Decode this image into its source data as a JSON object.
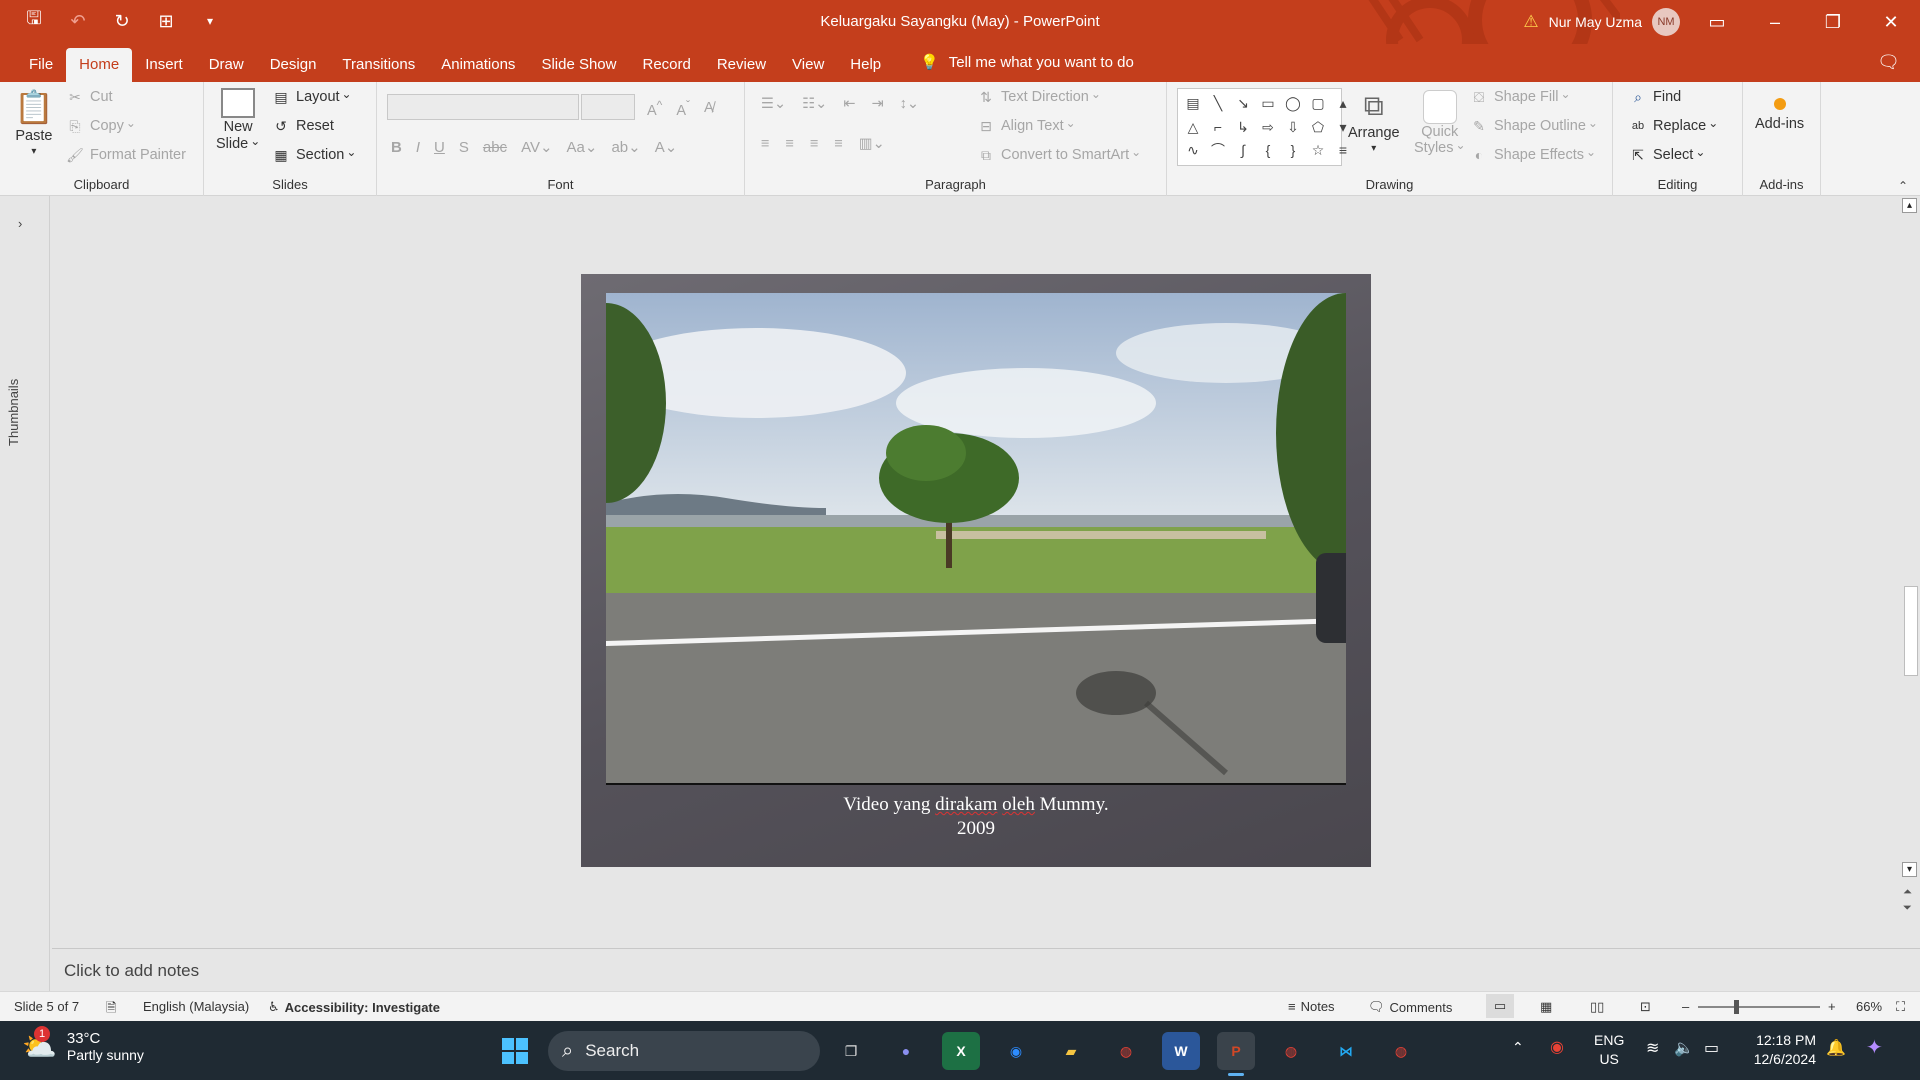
{
  "titlebar": {
    "document_title": "Keluargaku Sayangku (May)  -  PowerPoint",
    "user_name": "Nur May Uzma",
    "user_initials": "NM",
    "accent_color": "#c43e1c"
  },
  "tabs": [
    "File",
    "Home",
    "Insert",
    "Draw",
    "Design",
    "Transitions",
    "Animations",
    "Slide Show",
    "Record",
    "Review",
    "View",
    "Help"
  ],
  "active_tab": "Home",
  "tell_me": "Tell me what you want to do",
  "ribbon": {
    "clipboard": {
      "label": "Clipboard",
      "paste": "Paste",
      "cut": "Cut",
      "copy": "Copy",
      "format_painter": "Format Painter"
    },
    "slides": {
      "label": "Slides",
      "new_slide_1": "New",
      "new_slide_2": "Slide",
      "layout": "Layout",
      "reset": "Reset",
      "section": "Section"
    },
    "font": {
      "label": "Font"
    },
    "paragraph": {
      "label": "Paragraph",
      "text_direction": "Text Direction",
      "align_text": "Align Text",
      "convert_smartart": "Convert to SmartArt"
    },
    "drawing": {
      "label": "Drawing",
      "arrange": "Arrange",
      "quick_styles_1": "Quick",
      "quick_styles_2": "Styles",
      "shape_fill": "Shape Fill",
      "shape_outline": "Shape Outline",
      "shape_effects": "Shape Effects"
    },
    "editing": {
      "label": "Editing",
      "find": "Find",
      "replace": "Replace",
      "select": "Select"
    },
    "addins": {
      "label": "Add-ins",
      "button": "Add-ins"
    }
  },
  "thumbnails_label": "Thumbnails",
  "slide": {
    "caption_line1_a": "Video yang ",
    "caption_line1_b": "dirakam",
    "caption_line1_c": " ",
    "caption_line1_d": "oleh",
    "caption_line1_e": " Mummy.",
    "caption_line2": "2009"
  },
  "notes_placeholder": "Click to add notes",
  "status": {
    "slide_counter": "Slide 5 of 7",
    "language": "English (Malaysia)",
    "accessibility": "Accessibility: Investigate",
    "notes": "Notes",
    "comments": "Comments",
    "zoom": "66%",
    "zoom_fraction": 0.66
  },
  "taskbar": {
    "weather_temp": "33°C",
    "weather_desc": "Partly sunny",
    "weather_badge": "1",
    "search_label": "Search",
    "lang_1": "ENG",
    "lang_2": "US",
    "time": "12:18 PM",
    "date": "12/6/2024"
  }
}
